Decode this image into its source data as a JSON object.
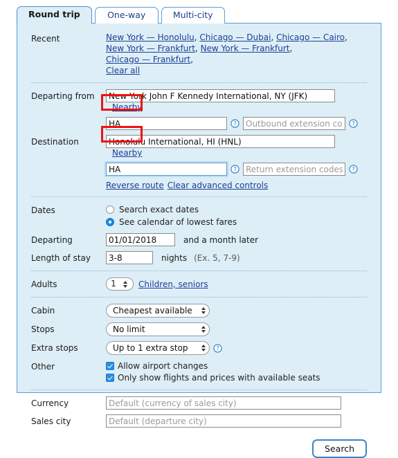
{
  "tabs": [
    {
      "label": "Round trip",
      "active": true
    },
    {
      "label": "One-way",
      "active": false
    },
    {
      "label": "Multi-city",
      "active": false
    }
  ],
  "labels": {
    "recent": "Recent",
    "departing_from": "Departing from",
    "destination": "Destination",
    "dates": "Dates",
    "departing": "Departing",
    "length_of_stay": "Length of stay",
    "adults": "Adults",
    "cabin": "Cabin",
    "stops": "Stops",
    "extra_stops": "Extra stops",
    "other": "Other",
    "currency": "Currency",
    "sales_city": "Sales city"
  },
  "recent": {
    "items": [
      "New York — Honolulu",
      "Chicago — Dubai",
      "Chicago — Cairo",
      "New York — Frankfurt",
      "New York — Frankfurt",
      "Chicago — Frankfurt"
    ],
    "clear_all": "Clear all",
    "separator": ", "
  },
  "origin": {
    "airport_value": "New York John F Kennedy International, NY (JFK)",
    "nearby_label": "Nearby",
    "code_value": "HA",
    "extension_placeholder": "Outbound extension codes",
    "help_icon": "help-circle-icon"
  },
  "destination": {
    "airport_value": "Honolulu International, HI (HNL)",
    "nearby_label": "Nearby",
    "code_value": "HA",
    "code_focused": true,
    "extension_placeholder": "Return extension codes",
    "help_icon": "help-circle-icon"
  },
  "route_links": {
    "reverse_route": "Reverse route",
    "clear_advanced": "Clear advanced controls"
  },
  "dates": {
    "options": [
      {
        "label": "Search exact dates",
        "selected": false
      },
      {
        "label": "See calendar of lowest fares",
        "selected": true
      }
    ],
    "departing_value": "01/01/2018",
    "departing_suffix": "and a month later",
    "stay_value": "3-8",
    "stay_unit": "nights",
    "stay_hint": "(Ex. 5, 7-9)"
  },
  "passengers": {
    "adults_value": "1",
    "children_link": "Children, seniors"
  },
  "options": {
    "cabin_value": "Cheapest available",
    "stops_value": "No limit",
    "extra_stops_value": "Up to 1 extra stop",
    "extra_stops_help_icon": "help-circle-icon",
    "checkboxes": [
      {
        "label": "Allow airport changes",
        "checked": true
      },
      {
        "label": "Only show flights and prices with available seats",
        "checked": true
      }
    ]
  },
  "locale": {
    "currency_placeholder": "Default (currency of sales city)",
    "sales_city_placeholder": "Default (departure city)"
  },
  "actions": {
    "search_label": "Search"
  },
  "colors": {
    "panel_bg": "#ddeef7",
    "panel_border": "#5b9bd5",
    "link": "#1b3f94",
    "accent": "#2a8fe0",
    "annotation": "#ee1111"
  }
}
